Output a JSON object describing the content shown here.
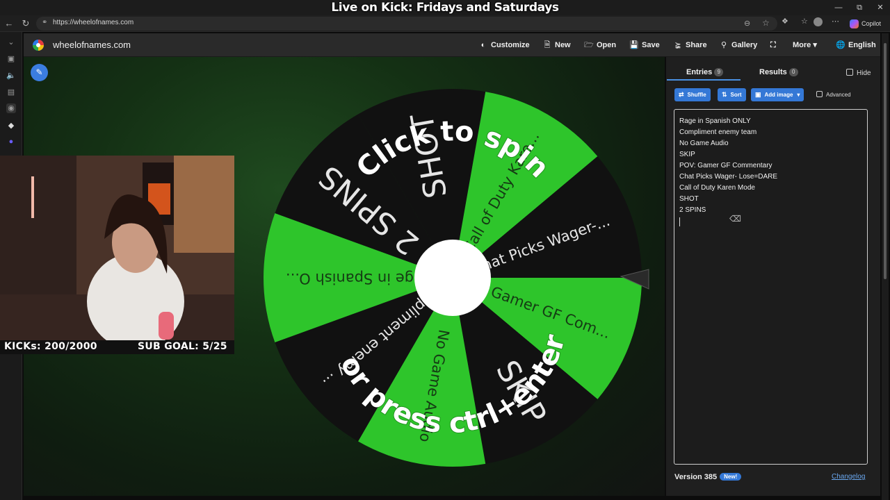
{
  "overlay": {
    "title": "Live on Kick: Fridays and Saturdays",
    "kicks": "KICKs: 200/2000",
    "sub_goal": "SUB GOAL: 5/25"
  },
  "browser": {
    "url": "https://wheelofnames.com",
    "copilot_label": "Copilot",
    "icons": [
      "back-icon",
      "reload-icon",
      "lock-icon",
      "reader-icon",
      "favorite-icon",
      "extensions-icon",
      "collections-icon",
      "profile-icon",
      "more-icon"
    ]
  },
  "site": {
    "logo_text": "wheelofnames.com",
    "menu": {
      "customize": "Customize",
      "new": "New",
      "open": "Open",
      "save": "Save",
      "share": "Share",
      "gallery": "Gallery",
      "more": "More",
      "language": "English"
    }
  },
  "wheel": {
    "segments": [
      "SHOT",
      "Call of Duty Kare...",
      "Chat Picks Wager-...",
      "POV: Gamer GF Com...",
      "SKIP",
      "No Game Audio",
      "Compliment enemy ...",
      "Rage in Spanish O...",
      "2 SPINS"
    ],
    "prompt_top": "Click to spin",
    "prompt_bottom": "or press ctrl+enter",
    "colors": {
      "green": "#2ec52b",
      "black": "#111111",
      "center": "#ffffff"
    }
  },
  "panel": {
    "tab_entries": "Entries",
    "tab_entries_count": "9",
    "tab_results": "Results",
    "tab_results_count": "0",
    "hide_label": "Hide",
    "shuffle_label": "Shuffle",
    "sort_label": "Sort",
    "add_image_label": "Add image",
    "advanced_label": "Advanced",
    "entries": [
      "Rage in Spanish ONLY",
      "Compliment enemy team",
      "No Game Audio",
      "SKIP",
      "POV: Gamer GF Commentary",
      "Chat Picks Wager- Lose=DARE",
      "Call of Duty Karen Mode",
      "SHOT",
      "2 SPINS"
    ],
    "version": "Version 385",
    "new_badge": "New!",
    "changelog": "Changelog"
  }
}
